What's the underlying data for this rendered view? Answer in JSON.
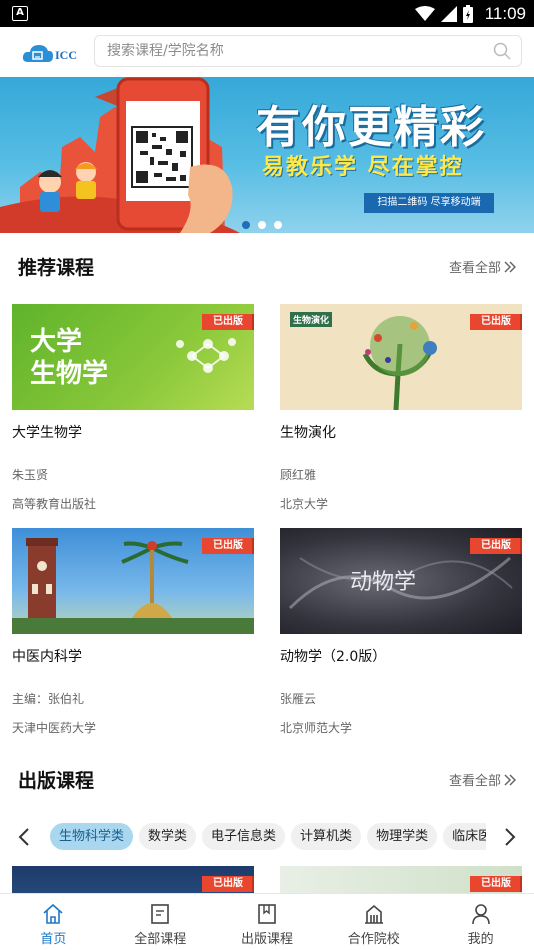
{
  "status_bar": {
    "time": "11:09"
  },
  "header": {
    "logo_text": "ICC",
    "search_placeholder": "搜索课程/学院名称"
  },
  "banner": {
    "headline": "有你更精彩",
    "subline": "易教乐学 尽在掌控",
    "cta": "扫描二维码 尽享移动端",
    "dots": 3,
    "active_dot": 0
  },
  "recommended": {
    "title": "推荐课程",
    "view_all": "查看全部",
    "courses": [
      {
        "title": "大学生物学",
        "author": "朱玉贤",
        "publisher": "高等教育出版社",
        "badge": "已出版",
        "cover_text": "大学\n生物学"
      },
      {
        "title": "生物演化",
        "author": "顾红雅",
        "publisher": "北京大学",
        "badge": "已出版",
        "cover_text": "生物演化"
      },
      {
        "title": "中医内科学",
        "author": "主编：张伯礼",
        "publisher": "天津中医药大学",
        "badge": "已出版",
        "cover_text": ""
      },
      {
        "title": "动物学（2.0版）",
        "author": "张雁云",
        "publisher": "北京师范大学",
        "badge": "已出版",
        "cover_text": "动物学"
      }
    ]
  },
  "published": {
    "title": "出版课程",
    "view_all": "查看全部",
    "categories": [
      "生物科学类",
      "数学类",
      "电子信息类",
      "计算机类",
      "物理学类",
      "临床医学类"
    ],
    "active_category": "生物科学类",
    "badge": "已出版"
  },
  "tabbar": {
    "items": [
      {
        "label": "首页",
        "icon": "home-icon",
        "active": true
      },
      {
        "label": "全部课程",
        "icon": "document-icon",
        "active": false
      },
      {
        "label": "出版课程",
        "icon": "book-icon",
        "active": false
      },
      {
        "label": "合作院校",
        "icon": "school-icon",
        "active": false
      },
      {
        "label": "我的",
        "icon": "user-icon",
        "active": false
      }
    ]
  },
  "colors": {
    "accent": "#1e78c8",
    "badge": "#e8462e",
    "chip_active": "#a9d7ef"
  }
}
